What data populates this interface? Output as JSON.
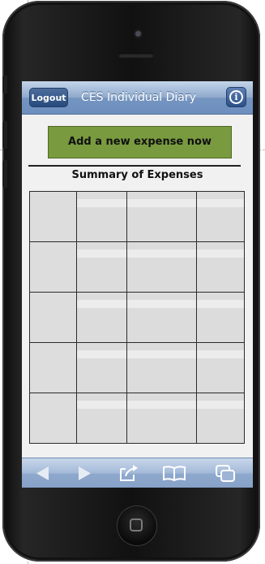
{
  "navbar": {
    "logout_label": "Logout",
    "title": "CES Individual Diary",
    "info_icon": "info-icon"
  },
  "main": {
    "add_expense_label": "Add a new expense now",
    "summary_title": "Summary of Expenses",
    "table": {
      "columns": 4,
      "rows": [
        [
          "",
          "",
          "",
          ""
        ],
        [
          "",
          "",
          "",
          ""
        ],
        [
          "",
          "",
          "",
          ""
        ],
        [
          "",
          "",
          "",
          ""
        ],
        [
          "",
          "",
          "",
          ""
        ]
      ]
    }
  },
  "toolbar": {
    "items": [
      "back-arrow-icon",
      "forward-arrow-icon",
      "share-icon",
      "bookmarks-icon",
      "tabs-icon"
    ],
    "disabled_color": "#e6ecf4"
  },
  "colors": {
    "nav_bar": "#7595c0",
    "add_button": "#799a3f",
    "content_bg": "#f1f1f1"
  }
}
